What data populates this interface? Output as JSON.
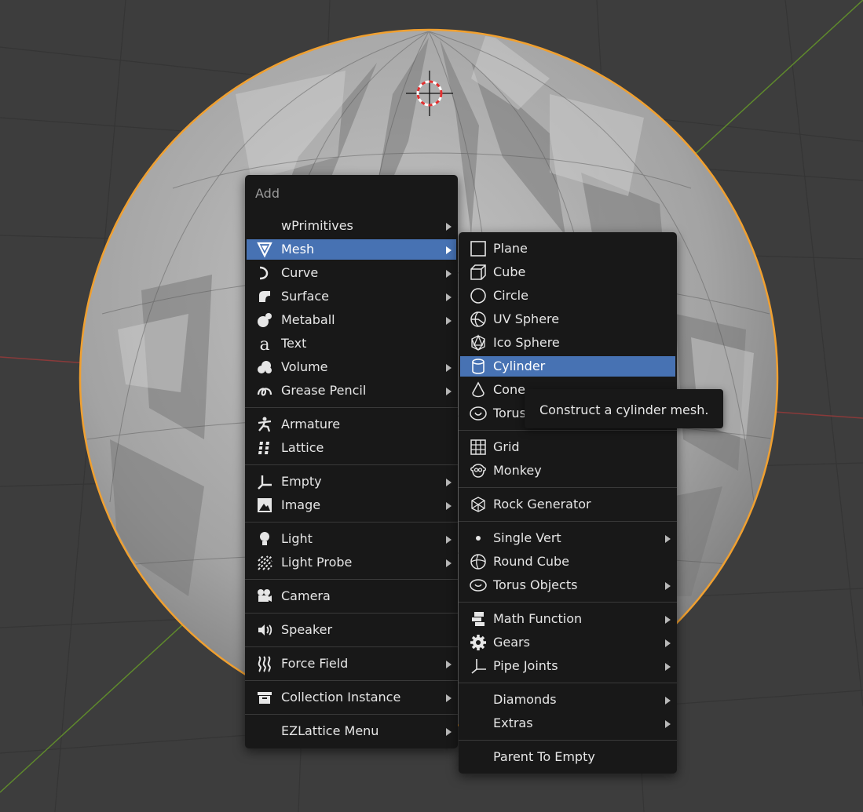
{
  "colors": {
    "viewport_bg": "#3d3d3d",
    "menu_bg": "#181818",
    "highlight": "#4772b3",
    "selection_outline": "#f0a030"
  },
  "add_menu": {
    "title": "Add",
    "items": [
      {
        "label": "wPrimitives",
        "icon": "none"
      },
      {
        "label": "Mesh",
        "icon": "mesh-icon"
      },
      {
        "label": "Curve",
        "icon": "curve-icon"
      },
      {
        "label": "Surface",
        "icon": "surface-icon"
      },
      {
        "label": "Metaball",
        "icon": "metaball-icon"
      },
      {
        "label": "Text",
        "icon": "text-icon"
      },
      {
        "label": "Volume",
        "icon": "volume-icon"
      },
      {
        "label": "Grease Pencil",
        "icon": "grease-pencil-icon"
      },
      {
        "label": "Armature",
        "icon": "armature-icon"
      },
      {
        "label": "Lattice",
        "icon": "lattice-icon"
      },
      {
        "label": "Empty",
        "icon": "empty-icon"
      },
      {
        "label": "Image",
        "icon": "image-icon"
      },
      {
        "label": "Light",
        "icon": "light-icon"
      },
      {
        "label": "Light Probe",
        "icon": "light-probe-icon"
      },
      {
        "label": "Camera",
        "icon": "camera-icon"
      },
      {
        "label": "Speaker",
        "icon": "speaker-icon"
      },
      {
        "label": "Force Field",
        "icon": "force-field-icon"
      },
      {
        "label": "Collection Instance",
        "icon": "collection-instance-icon"
      },
      {
        "label": "EZLattice Menu",
        "icon": "none"
      }
    ]
  },
  "mesh_menu": {
    "items": [
      {
        "label": "Plane",
        "icon": "plane-icon"
      },
      {
        "label": "Cube",
        "icon": "cube-icon"
      },
      {
        "label": "Circle",
        "icon": "circle-icon"
      },
      {
        "label": "UV Sphere",
        "icon": "uv-sphere-icon"
      },
      {
        "label": "Ico Sphere",
        "icon": "ico-sphere-icon"
      },
      {
        "label": "Cylinder",
        "icon": "cylinder-icon"
      },
      {
        "label": "Cone",
        "icon": "cone-icon"
      },
      {
        "label": "Torus",
        "icon": "torus-icon"
      },
      {
        "label": "Grid",
        "icon": "grid-icon"
      },
      {
        "label": "Monkey",
        "icon": "monkey-icon"
      },
      {
        "label": "Rock Generator",
        "icon": "rock-icon"
      },
      {
        "label": "Single Vert",
        "icon": "dot-icon"
      },
      {
        "label": "Round Cube",
        "icon": "round-cube-icon"
      },
      {
        "label": "Torus Objects",
        "icon": "torus-objects-icon"
      },
      {
        "label": "Math Function",
        "icon": "math-function-icon"
      },
      {
        "label": "Gears",
        "icon": "gear-icon"
      },
      {
        "label": "Pipe Joints",
        "icon": "pipe-joints-icon"
      },
      {
        "label": "Diamonds",
        "icon": "none"
      },
      {
        "label": "Extras",
        "icon": "none"
      },
      {
        "label": "Parent To Empty",
        "icon": "none"
      }
    ]
  },
  "tooltip": {
    "text": "Construct a cylinder mesh."
  }
}
